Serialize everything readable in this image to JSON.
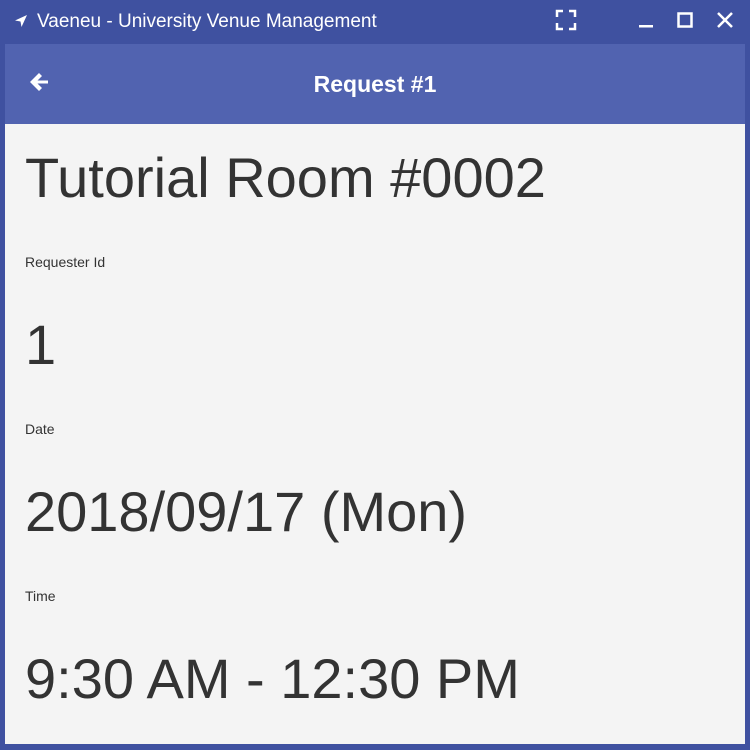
{
  "window": {
    "title": "Vaeneu - University Venue Management",
    "colors": {
      "titlebar": "#3f51a0",
      "appbar": "#5163b0",
      "content_bg": "#f4f4f4",
      "text": "#333333"
    },
    "icons": {
      "app": "navigation-arrow-icon",
      "fullscreen": "fullscreen-icon",
      "minimize": "minimize-icon",
      "maximize": "maximize-icon",
      "close": "close-icon"
    }
  },
  "appbar": {
    "title": "Request #1",
    "back_icon": "arrow-left-icon"
  },
  "request": {
    "venue": "Tutorial Room #0002",
    "requester_label": "Requester Id",
    "requester_value": "1",
    "date_label": "Date",
    "date_value": "2018/09/17 (Mon)",
    "time_label": "Time",
    "time_value": "9:30 AM - 12:30 PM"
  }
}
